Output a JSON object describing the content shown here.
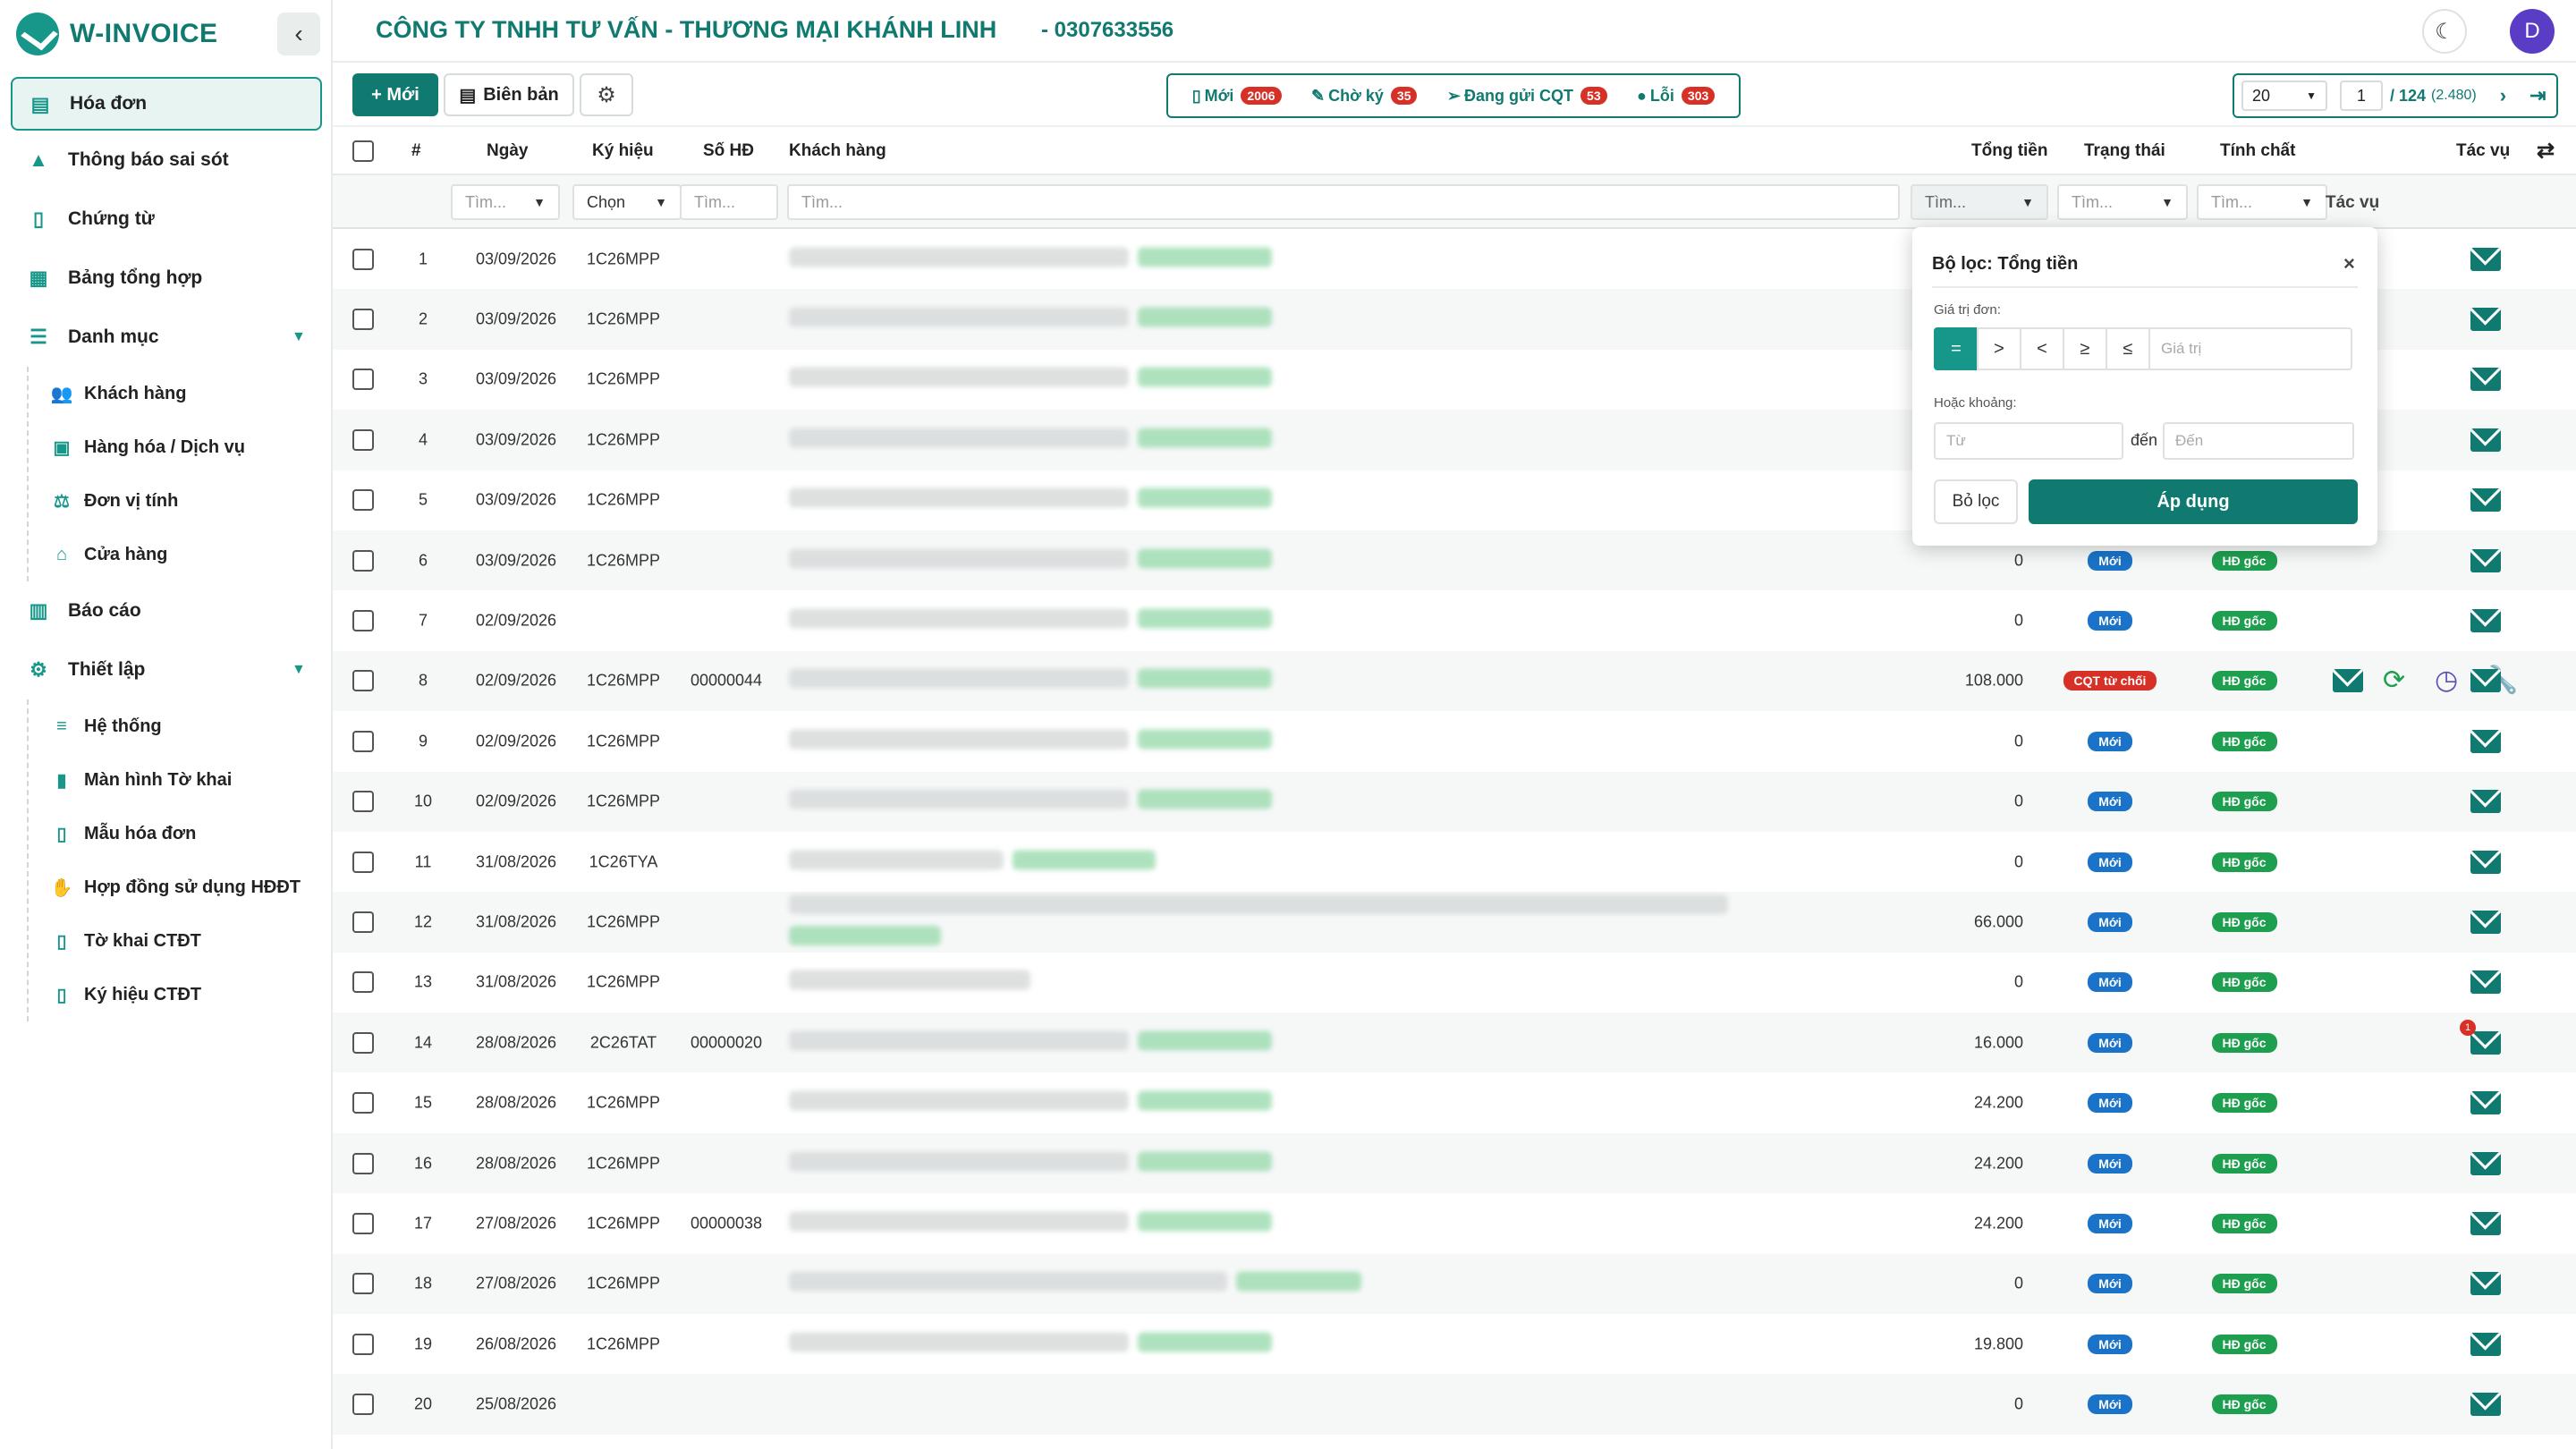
{
  "brand": {
    "name": "W-INVOICE"
  },
  "header": {
    "company": "CÔNG TY TNHH TƯ VẤN - THƯƠNG MẠI KHÁNH LINH",
    "tax_code": "- 0307633556",
    "avatar_letter": "D"
  },
  "sidebar": {
    "items": [
      {
        "label": "Hóa đơn",
        "icon": "invoice-icon",
        "active": true
      },
      {
        "label": "Thông báo sai sót",
        "icon": "warning-icon"
      },
      {
        "label": "Chứng từ",
        "icon": "document-icon"
      },
      {
        "label": "Bảng tổng hợp",
        "icon": "table-icon"
      },
      {
        "label": "Danh mục",
        "icon": "list-icon",
        "expandable": true
      },
      {
        "label": "Báo cáo",
        "icon": "chart-icon"
      },
      {
        "label": "Thiết lập",
        "icon": "settings-icon",
        "expandable": true
      }
    ],
    "danh_muc": [
      "Khách hàng",
      "Hàng hóa / Dịch vụ",
      "Đơn vị tính",
      "Cửa hàng"
    ],
    "thiet_lap": [
      "Hệ thống",
      "Màn hình Tờ khai",
      "Mẫu hóa đơn",
      "Hợp đồng sử dụng HĐĐT",
      "Tờ khai CTĐT",
      "Ký hiệu CTĐT"
    ]
  },
  "toolbar": {
    "new_label": "+ Mới",
    "minutes_label": "Biên bản",
    "status": [
      {
        "label": "Mới",
        "count": "2006",
        "icon": "file-icon"
      },
      {
        "label": "Chờ ký",
        "count": "35",
        "icon": "edit-icon"
      },
      {
        "label": "Đang gửi CQT",
        "count": "53",
        "icon": "send-icon"
      },
      {
        "label": "Lỗi",
        "count": "303",
        "icon": "alert-icon"
      }
    ],
    "pager": {
      "size": "20",
      "page": "1",
      "total": "/ 124",
      "count": "(2.480)"
    }
  },
  "columns": {
    "idx": "#",
    "date": "Ngày",
    "symbol": "Ký hiệu",
    "number": "Số HĐ",
    "customer": "Khách hàng",
    "total": "Tổng tiền",
    "status": "Trạng thái",
    "nature": "Tính chất",
    "actions": "Tác vụ"
  },
  "filters": {
    "date": "Tìm...",
    "symbol": "Chọn",
    "number": "Tìm...",
    "customer": "Tìm...",
    "total": "Tìm...",
    "status": "Tìm...",
    "nature": "Tìm...",
    "actions": "Tác vụ"
  },
  "rows": [
    {
      "idx": "1",
      "date": "03/09/2026",
      "symbol": "1C26MPP",
      "number": "",
      "total": "",
      "status": "",
      "nature": ""
    },
    {
      "idx": "2",
      "date": "03/09/2026",
      "symbol": "1C26MPP",
      "number": "",
      "total": "",
      "status": "",
      "nature": ""
    },
    {
      "idx": "3",
      "date": "03/09/2026",
      "symbol": "1C26MPP",
      "number": "",
      "total": "",
      "status": "",
      "nature": ""
    },
    {
      "idx": "4",
      "date": "03/09/2026",
      "symbol": "1C26MPP",
      "number": "",
      "total": "",
      "status": "",
      "nature": ""
    },
    {
      "idx": "5",
      "date": "03/09/2026",
      "symbol": "1C26MPP",
      "number": "",
      "total": "",
      "status": "",
      "nature": ""
    },
    {
      "idx": "6",
      "date": "03/09/2026",
      "symbol": "1C26MPP",
      "number": "",
      "total": "0",
      "status": "Mới",
      "nature": "HĐ gốc"
    },
    {
      "idx": "7",
      "date": "02/09/2026",
      "symbol": "",
      "number": "",
      "total": "0",
      "status": "Mới",
      "nature": "HĐ gốc"
    },
    {
      "idx": "8",
      "date": "02/09/2026",
      "symbol": "1C26MPP",
      "number": "00000044",
      "total": "108.000",
      "status": "CQT từ chối",
      "nature": "HĐ gốc",
      "extra_actions": true
    },
    {
      "idx": "9",
      "date": "02/09/2026",
      "symbol": "1C26MPP",
      "number": "",
      "total": "0",
      "status": "Mới",
      "nature": "HĐ gốc"
    },
    {
      "idx": "10",
      "date": "02/09/2026",
      "symbol": "1C26MPP",
      "number": "",
      "total": "0",
      "status": "Mới",
      "nature": "HĐ gốc"
    },
    {
      "idx": "11",
      "date": "31/08/2026",
      "symbol": "1C26TYA",
      "number": "",
      "total": "0",
      "status": "Mới",
      "nature": "HĐ gốc"
    },
    {
      "idx": "12",
      "date": "31/08/2026",
      "symbol": "1C26MPP",
      "number": "",
      "total": "66.000",
      "status": "Mới",
      "nature": "HĐ gốc"
    },
    {
      "idx": "13",
      "date": "31/08/2026",
      "symbol": "1C26MPP",
      "number": "",
      "total": "0",
      "status": "Mới",
      "nature": "HĐ gốc"
    },
    {
      "idx": "14",
      "date": "28/08/2026",
      "symbol": "2C26TAT",
      "number": "00000020",
      "total": "16.000",
      "status": "Mới",
      "nature": "HĐ gốc",
      "notif": "1"
    },
    {
      "idx": "15",
      "date": "28/08/2026",
      "symbol": "1C26MPP",
      "number": "",
      "total": "24.200",
      "status": "Mới",
      "nature": "HĐ gốc"
    },
    {
      "idx": "16",
      "date": "28/08/2026",
      "symbol": "1C26MPP",
      "number": "",
      "total": "24.200",
      "status": "Mới",
      "nature": "HĐ gốc"
    },
    {
      "idx": "17",
      "date": "27/08/2026",
      "symbol": "1C26MPP",
      "number": "00000038",
      "total": "24.200",
      "status": "Mới",
      "nature": "HĐ gốc"
    },
    {
      "idx": "18",
      "date": "27/08/2026",
      "symbol": "1C26MPP",
      "number": "",
      "total": "0",
      "status": "Mới",
      "nature": "HĐ gốc"
    },
    {
      "idx": "19",
      "date": "26/08/2026",
      "symbol": "1C26MPP",
      "number": "",
      "total": "19.800",
      "status": "Mới",
      "nature": "HĐ gốc"
    },
    {
      "idx": "20",
      "date": "25/08/2026",
      "symbol": "",
      "number": "",
      "total": "0",
      "status": "Mới",
      "nature": "HĐ gốc"
    }
  ],
  "popup": {
    "title": "Bộ lọc: Tổng tiền",
    "single_label": "Giá trị đơn:",
    "operators": [
      "=",
      ">",
      "<",
      "≥",
      "≤"
    ],
    "value_placeholder": "Giá trị",
    "range_label": "Hoặc khoảng:",
    "from_placeholder": "Từ",
    "between": "đến",
    "to_placeholder": "Đến",
    "clear_label": "Bỏ lọc",
    "apply_label": "Áp dụng"
  },
  "colors": {
    "primary": "#117a70",
    "accent": "#17968a",
    "new": "#1a73c8",
    "origin": "#1e9e4f",
    "error": "#d63027"
  }
}
